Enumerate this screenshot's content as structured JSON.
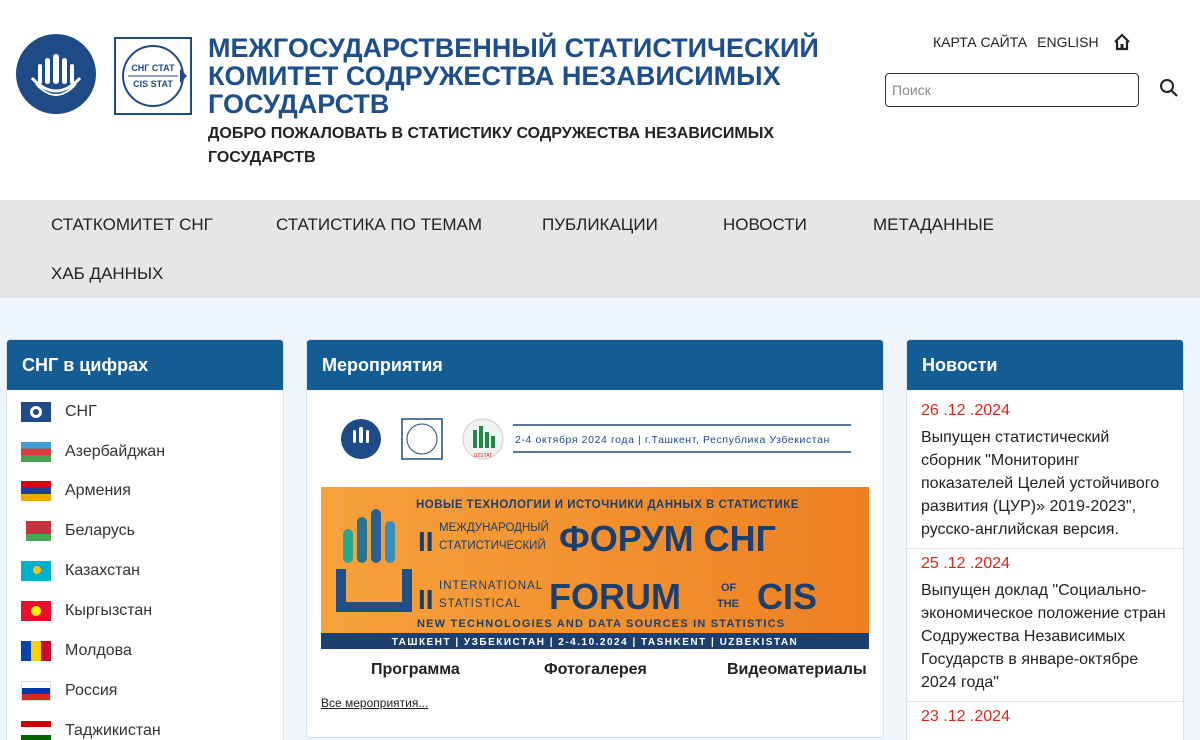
{
  "header": {
    "title": "Межгосударственный статистический комитет Содружества Независимых Государств",
    "subtitle": "ДОБРО ПОЖАЛОВАТЬ В СТАТИСТИКУ СОДРУЖЕСТВА НЕЗАВИСИМЫХ ГОСУДАРСТВ",
    "sitemap": "КАРТА САЙТА",
    "english": "ENGLISH",
    "logo_text_top": "СНГ СТАТ",
    "logo_text_bottom": "CIS STAT",
    "search_placeholder": "Поиск"
  },
  "nav": [
    "СТАТКОМИТЕТ СНГ",
    "СТАТИСТИКА ПО ТЕМАМ",
    "ПУБЛИКАЦИИ",
    "НОВОСТИ",
    "МЕТАДАННЫЕ",
    "ХАБ ДАННЫХ"
  ],
  "cis_numbers": {
    "heading": "СНГ в цифрах",
    "countries": [
      "СНГ",
      "Азербайджан",
      "Армения",
      "Беларусь",
      "Казахстан",
      "Кыргызстан",
      "Молдова",
      "Россия",
      "Таджикистан"
    ]
  },
  "events": {
    "heading": "Мероприятия",
    "logo_caption": "2-4 октября 2024 года | г.Ташкент, Республика Узбекистан",
    "uzstat_label": "UZSTAT",
    "banner": {
      "top": "НОВЫЕ ТЕХНОЛОГИИ И ИСТОЧНИКИ ДАННЫХ В СТАТИСТИКЕ",
      "ru_small_1": "МЕЖДУНАРОДНЫЙ",
      "ru_small_2": "СТАТИСТИЧЕСКИЙ",
      "ru_big": "ФОРУМ СНГ",
      "en_small_1": "INTERNATIONAL",
      "en_small_2": "STATISTICAL",
      "en_big": "FORUM",
      "en_of": "OF",
      "en_the": "THE",
      "en_cis": "CIS",
      "en_bottom": "NEW TECHNOLOGIES AND DATA SOURCES IN STATISTICS",
      "roman": "II",
      "footer": "ТАШКЕНТ | УЗБЕКИСТАН | 2-4.10.2024 | TASHKENT | UZBEKISTAN"
    },
    "links": [
      "Программа",
      "Фотогалерея",
      "Видеоматериалы"
    ],
    "all": "Все мероприятия..."
  },
  "news": {
    "heading": "Новости",
    "items": [
      {
        "date": "26 .12 .2024",
        "text": "Выпущен статистический сборник \"Мониторинг показателей Целей устойчивого развития (ЦУР)» 2019-2023\", русско-английская версия."
      },
      {
        "date": "25 .12 .2024",
        "text": "Выпущен доклад \"Социально-экономическое положение стран Содружества Независимых Государств в январе-октябре 2024 года\""
      },
      {
        "date": "23 .12 .2024",
        "text": ""
      }
    ]
  },
  "colors": {
    "brand_blue": "#135d94",
    "title_blue": "#1f4f8a",
    "date_red": "#d9261c",
    "banner_orange": "#f08a2c"
  }
}
